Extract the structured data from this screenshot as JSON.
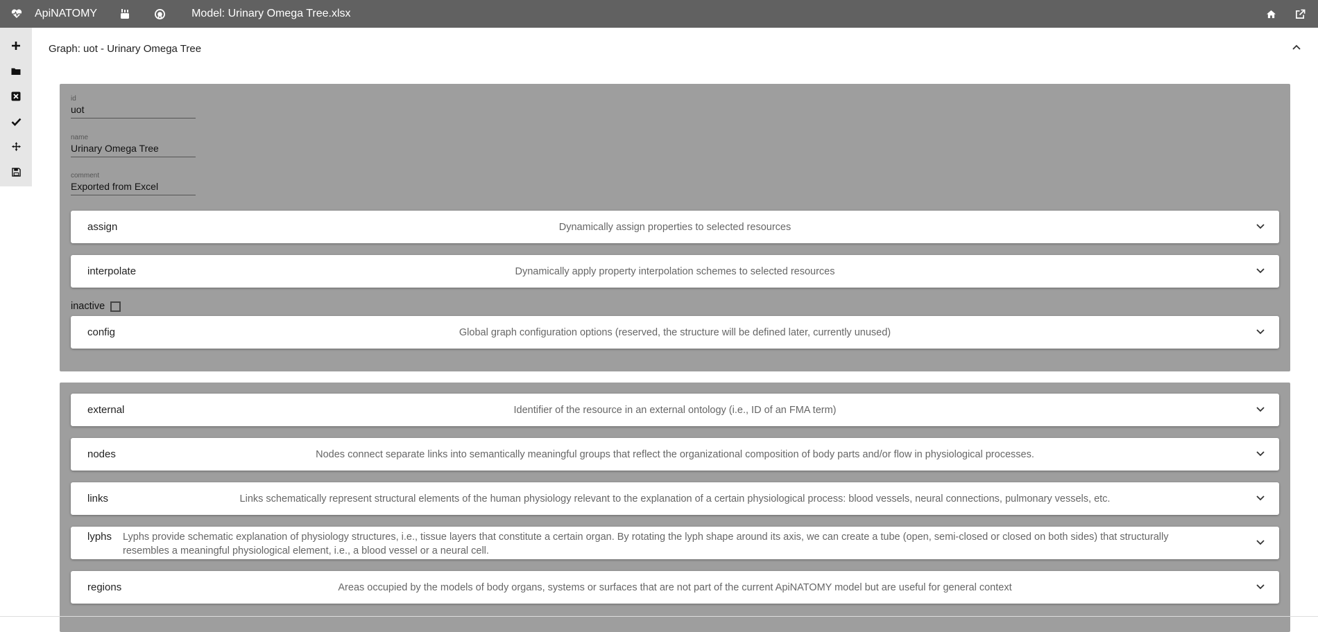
{
  "app": {
    "brand": "ApiNATOMY",
    "model_title": "Model: Urinary Omega Tree.xlsx"
  },
  "toolbar_icons": [
    "plus-icon",
    "folder-icon",
    "close-box-icon",
    "check-icon",
    "move-icon",
    "save-icon"
  ],
  "graph": {
    "header": "Graph: uot - Urinary Omega Tree"
  },
  "fields": [
    {
      "label": "id",
      "value": "uot"
    },
    {
      "label": "name",
      "value": "Urinary Omega Tree"
    },
    {
      "label": "comment",
      "value": "Exported from Excel"
    }
  ],
  "group1": [
    {
      "name": "assign",
      "desc": "Dynamically assign properties to selected resources"
    },
    {
      "name": "interpolate",
      "desc": "Dynamically apply property interpolation schemes to selected resources"
    }
  ],
  "inactive_label": "inactive",
  "config": {
    "name": "config",
    "desc": "Global graph configuration options (reserved, the structure will be defined later, currently unused)"
  },
  "group2": [
    {
      "name": "external",
      "desc": "Identifier of the resource in an external ontology (i.e., ID of an FMA term)"
    },
    {
      "name": "nodes",
      "desc": "Nodes connect separate links into semantically meaningful groups that reflect the organizational composition of body parts and/or flow in physiological processes."
    },
    {
      "name": "links",
      "desc": "Links schematically represent structural elements of the human physiology relevant to the explanation of a certain physiological process: blood vessels, neural connections, pulmonary vessels, etc."
    },
    {
      "name": "lyphs",
      "desc": "Lyphs provide schematic explanation of physiology structures, i.e., tissue layers that constitute a certain organ. By rotating the lyph shape around its axis, we can create a tube (open, semi-closed or closed on both sides) that structurally resembles a meaningful physiological element, i.e., a blood vessel or a neural cell."
    },
    {
      "name": "regions",
      "desc": "Areas occupied by the models of body organs, systems or surfaces that are not part of the current ApiNATOMY model but are useful for general context"
    }
  ]
}
